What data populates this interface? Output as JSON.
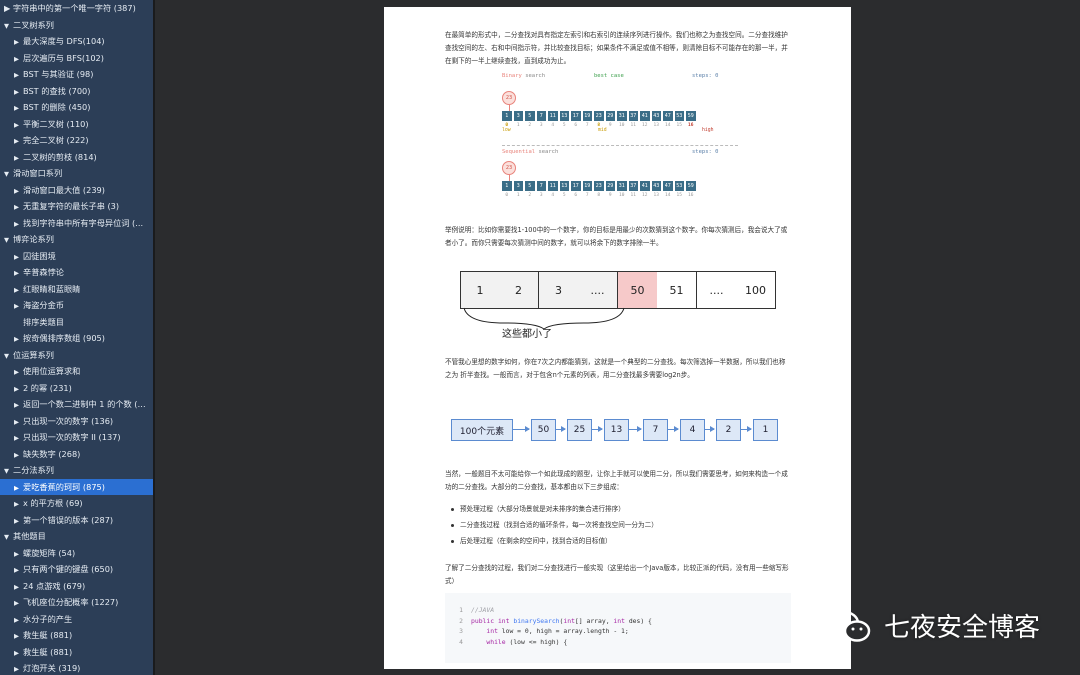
{
  "sidebar": {
    "items": [
      {
        "level": "sub2",
        "label": "▶ 字符串中的第一个唯一字符 (387)"
      },
      {
        "level": "cat",
        "label": "二叉树系列"
      },
      {
        "level": "sub",
        "label": "最大深度与 DFS(104)"
      },
      {
        "level": "sub",
        "label": "层次遍历与 BFS(102)"
      },
      {
        "level": "sub",
        "label": "BST 与其验证 (98)"
      },
      {
        "level": "sub",
        "label": "BST 的查找 (700)"
      },
      {
        "level": "sub",
        "label": "BST 的删除 (450)"
      },
      {
        "level": "sub",
        "label": "平衡二叉树 (110)"
      },
      {
        "level": "sub",
        "label": "完全二叉树 (222)"
      },
      {
        "level": "sub",
        "label": "二叉树的剪枝 (814)"
      },
      {
        "level": "cat",
        "label": "滑动窗口系列"
      },
      {
        "level": "sub",
        "label": "滑动窗口最大值 (239)"
      },
      {
        "level": "sub",
        "label": "无重复字符的最长子串 (3)"
      },
      {
        "level": "sub",
        "label": "找到字符串中所有字母异位词 (..."
      },
      {
        "level": "cat",
        "label": "博弈论系列"
      },
      {
        "level": "sub",
        "label": "囚徒困境"
      },
      {
        "level": "sub",
        "label": "辛普森悖论"
      },
      {
        "level": "sub",
        "label": "红眼睛和蓝眼睛"
      },
      {
        "level": "sub",
        "label": "海盗分金币"
      },
      {
        "level": "sub",
        "label": "排序类题目",
        "notri": true
      },
      {
        "level": "sub",
        "label": "按奇偶排序数组 (905)"
      },
      {
        "level": "cat",
        "label": "位运算系列"
      },
      {
        "level": "sub",
        "label": "使用位运算求和"
      },
      {
        "level": "sub",
        "label": "2 的幂 (231)"
      },
      {
        "level": "sub",
        "label": "返回一个数二进制中 1 的个数 (19..."
      },
      {
        "level": "sub",
        "label": "只出现一次的数字 (136)"
      },
      {
        "level": "sub",
        "label": "只出现一次的数字 II (137)"
      },
      {
        "level": "sub",
        "label": "缺失数字 (268)"
      },
      {
        "level": "cat",
        "label": "二分法系列"
      },
      {
        "level": "sub",
        "label": "爱吃香蕉的珂珂 (875)",
        "active": true
      },
      {
        "level": "sub",
        "label": "x 的平方根 (69)"
      },
      {
        "level": "sub",
        "label": "第一个错误的版本 (287)"
      },
      {
        "level": "cat",
        "label": "其他题目"
      },
      {
        "level": "sub",
        "label": "螺旋矩阵 (54)"
      },
      {
        "level": "sub",
        "label": "只有两个键的键盘 (650)"
      },
      {
        "level": "sub",
        "label": "24 点游戏 (679)"
      },
      {
        "level": "sub",
        "label": "飞机座位分配概率 (1227)"
      },
      {
        "level": "sub",
        "label": "水分子的产生"
      },
      {
        "level": "sub",
        "label": "救生艇 (881)"
      },
      {
        "level": "sub",
        "label": "救生艇 (881)"
      },
      {
        "level": "sub",
        "label": "灯泡开关 (319)"
      }
    ]
  },
  "doc": {
    "p1": "在最简单的形式中，二分查找对具有指定左索引和右索引的连续序列进行操作。我们也称之为查找空间。二分查找维护查找空间的左、右和中间指示符，并比较查找目标；如果条件不满足或值不相等，则清除目标不可能存在的那一半，并在剩下的一半上继续查找，直到成功为止。",
    "anim1": {
      "title1": "Binary",
      "title2": "search",
      "mode": "best case",
      "steps": "steps: 0",
      "target": "23",
      "low": "low",
      "mid": "mid",
      "high": "high",
      "lowi": "0",
      "midi": "8",
      "highi": "16"
    },
    "anim2": {
      "title1": "Sequential",
      "title2": "search",
      "steps": "steps: 0",
      "target": "23"
    },
    "array": [
      "1",
      "3",
      "5",
      "7",
      "11",
      "13",
      "17",
      "19",
      "23",
      "29",
      "31",
      "37",
      "41",
      "43",
      "47",
      "53",
      "59"
    ],
    "indices": [
      "0",
      "1",
      "2",
      "3",
      "4",
      "5",
      "6",
      "7",
      "8",
      "9",
      "10",
      "11",
      "12",
      "13",
      "14",
      "15",
      "16"
    ],
    "p2": "举例说明：比如你需要找1-100中的一个数字，你的目标是用最少的次数猜到这个数字。你每次猜测后，我会说大了或者小了。而你只需要每次猜测中间的数字，就可以将余下的数字排除一半。",
    "boxes": [
      "1",
      "2",
      "3",
      "....",
      "50",
      "51",
      "....",
      "100"
    ],
    "boxes_note": "这些都小了",
    "p3": "不管我心里想的数字如何，你在7次之内都能猜到，这就是一个典型的二分查找。每次筛选掉一半数据，所以我们也称之为 折半查找。一般而言，对于包含n个元素的列表，用二分查找最多需要log2n步。",
    "chain": [
      "100个元素",
      "50",
      "25",
      "13",
      "7",
      "4",
      "2",
      "1"
    ],
    "p4": "当然，一般题目不太可能给你一个如此现成的题型，让你上手就可以使用二分，所以我们需要思考，如何来构造一个成功的二分查找。大部分的二分查找，基本都由以下三步组成：",
    "bullets": [
      "预处理过程（大部分场景就是对未排序的集合进行排序）",
      "二分查找过程（找到合适的循环条件，每一次将查找空间一分为二）",
      "后处理过程（在剩余的空间中，找到合适的目标值）"
    ],
    "p5": "了解了二分查找的过程，我们对二分查找进行一般实现（这里给出一个Java版本，比较正派的代码，没有用一些缩写形式）",
    "code": [
      {
        "n": "1",
        "t": "//JAVA"
      },
      {
        "n": "2",
        "t": "public int binarySearch(int[] array, int des) {"
      },
      {
        "n": "3",
        "t": "    int low = 0, high = array.length - 1;"
      },
      {
        "n": "4",
        "t": "    while (low <= high) {"
      }
    ]
  },
  "watermark": {
    "text": "七夜安全博客"
  },
  "colors": {
    "sidebar_bg": "#2c3e57",
    "active": "#2b6fd2",
    "cell": "#3a6d87",
    "highlight_box": "#f6c9c9",
    "chain_fill": "#dde8f7"
  }
}
